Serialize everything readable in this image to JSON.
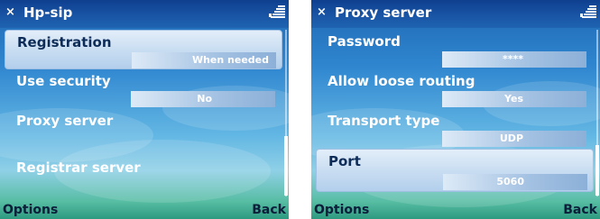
{
  "screens": [
    {
      "title": "Hp-sip",
      "close_glyph": "×",
      "items": [
        {
          "label": "Registration",
          "value": "When needed",
          "selected": true
        },
        {
          "label": "Use security",
          "value": "No",
          "selected": false
        },
        {
          "label": "Proxy server",
          "value": null,
          "selected": false
        },
        {
          "label": "Registrar server",
          "value": null,
          "selected": false
        }
      ],
      "softkeys": {
        "left": "Options",
        "right": "Back"
      }
    },
    {
      "title": "Proxy server",
      "close_glyph": "×",
      "items": [
        {
          "label": "Password",
          "value": "****",
          "selected": false
        },
        {
          "label": "Allow loose routing",
          "value": "Yes",
          "selected": false
        },
        {
          "label": "Transport type",
          "value": "UDP",
          "selected": false
        },
        {
          "label": "Port",
          "value": "5060",
          "selected": true
        }
      ],
      "softkeys": {
        "left": "Options",
        "right": "Back"
      }
    }
  ],
  "colors": {
    "title_bar": "#1a56a6",
    "selected_item": "#c7dcf1",
    "softkey_text": "#0b1e3a"
  }
}
